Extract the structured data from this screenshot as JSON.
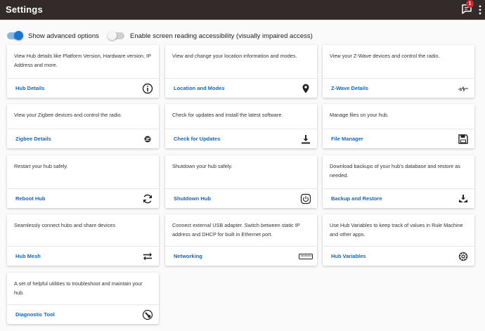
{
  "header": {
    "title": "Settings",
    "notification_count": "1"
  },
  "toggles": [
    {
      "label": "Show advanced options",
      "state": "on"
    },
    {
      "label": "Enable screen reading accessibility (visually impaired access)",
      "state": "off"
    }
  ],
  "cards": [
    {
      "description": "View Hub details like Platform Version, Hardware version, IP Address and more.",
      "link": "Hub Details",
      "icon": "info-icon"
    },
    {
      "description": "View and change your location information and modes.",
      "link": "Location and Modes",
      "icon": "map-pin-icon"
    },
    {
      "description": "View your Z-Wave devices and control the radio.",
      "link": "Z-Wave Details",
      "icon": "zwave-icon"
    },
    {
      "description": "View your Zigbee devices and control the radio.",
      "link": "Zigbee Details",
      "icon": "zigbee-icon"
    },
    {
      "description": "Check for updates and install the latest software.",
      "link": "Check for Updates",
      "icon": "download-icon"
    },
    {
      "description": "Manage files on your hub.",
      "link": "File Manager",
      "icon": "save-icon"
    },
    {
      "description": "Restart your hub safely.",
      "link": "Reboot Hub",
      "icon": "refresh-icon"
    },
    {
      "description": "Shutdown your hub safely.",
      "link": "Shutdown Hub",
      "icon": "power-icon"
    },
    {
      "description": "Download backups of your hub's database and restore as needed.",
      "link": "Backup and Restore",
      "icon": "backup-icon"
    },
    {
      "description": "Seamlessly connect hubs and share devices",
      "link": "Hub Mesh",
      "icon": "swap-icon"
    },
    {
      "description": "Connect external USB adapter. Switch between static IP address and DHCP for built in Ethernet port.",
      "link": "Networking",
      "icon": "ethernet-icon"
    },
    {
      "description": "Use Hub Variables to keep track of values in Rule Machine and other apps.",
      "link": "Hub Variables",
      "icon": "gear-icon"
    },
    {
      "description": "A set of helpful utilities to troubleshoot and maintain your hub.",
      "link": "Diagnostic Tool",
      "icon": "diagnostic-icon"
    }
  ]
}
